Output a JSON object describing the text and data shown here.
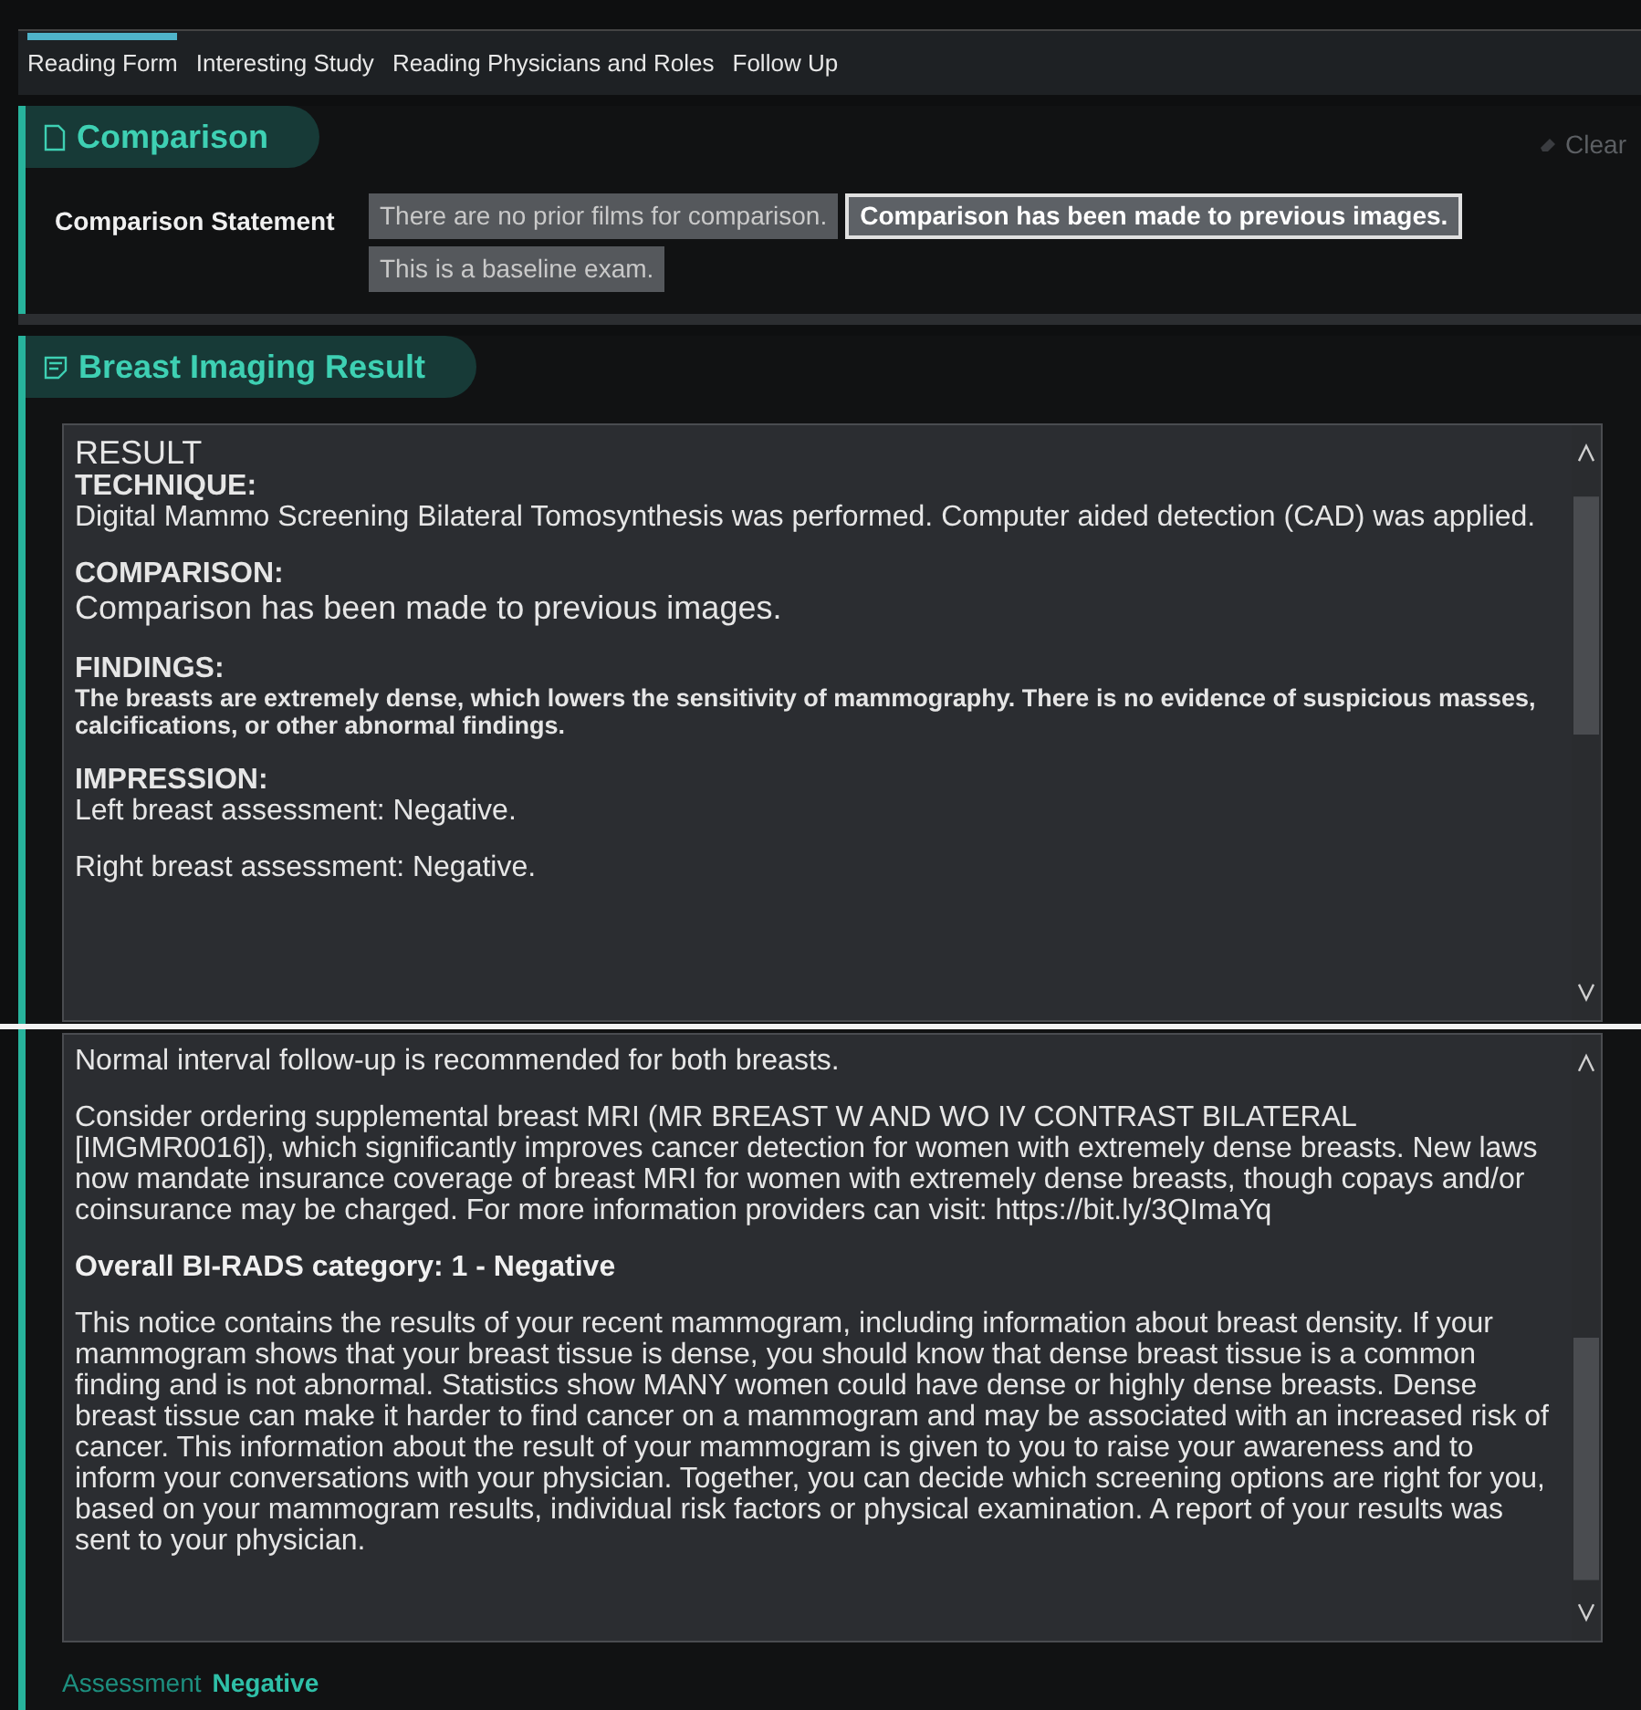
{
  "tabs": [
    {
      "label": "Reading Form",
      "selected": true
    },
    {
      "label": "Interesting Study",
      "selected": false
    },
    {
      "label": "Reading Physicians and Roles",
      "selected": false
    },
    {
      "label": "Follow Up",
      "selected": false
    }
  ],
  "comparison": {
    "title": "Comparison",
    "clear": "Clear",
    "statement_label": "Comparison Statement",
    "options": [
      {
        "label": "There are no prior films for comparison.",
        "selected": false
      },
      {
        "label": "Comparison has been made to previous images.",
        "selected": true
      },
      {
        "label": "This is a baseline exam.",
        "selected": false
      }
    ]
  },
  "result": {
    "title": "Breast Imaging Result",
    "panes": [
      {
        "blocks": [
          {
            "kind": "title",
            "text": "RESULT"
          },
          {
            "kind": "heading",
            "text": "TECHNIQUE:"
          },
          {
            "kind": "body",
            "text": "Digital Mammo Screening Bilateral Tomosynthesis was performed.  Computer aided detection (CAD) was applied."
          },
          {
            "kind": "heading",
            "text": "COMPARISON:"
          },
          {
            "kind": "large",
            "text": "Comparison has been made to previous images."
          },
          {
            "kind": "heading",
            "text": "FINDINGS:"
          },
          {
            "kind": "fine",
            "text": "The breasts are extremely dense, which lowers the sensitivity of mammography. There is no evidence of suspicious masses, calcifications, or other abnormal findings."
          },
          {
            "kind": "heading",
            "text": "IMPRESSION:"
          },
          {
            "kind": "body",
            "text": "Left breast assessment: Negative."
          },
          {
            "kind": "body",
            "text": "Right breast assessment: Negative."
          }
        ]
      },
      {
        "blocks": [
          {
            "kind": "body",
            "text": "Normal interval follow-up is recommended for both breasts."
          },
          {
            "kind": "body",
            "text": "Consider ordering supplemental breast MRI (MR BREAST W AND WO IV CONTRAST BILATERAL [IMGMR0016]), which significantly improves cancer detection for women with extremely dense breasts. New laws now mandate insurance coverage of breast MRI for women with extremely dense breasts, though copays and/or coinsurance may be charged. For more information providers can visit: https://bit.ly/3QImaYq"
          },
          {
            "kind": "emphasis",
            "text": "Overall BI-RADS category: 1 - Negative"
          },
          {
            "kind": "body",
            "text": "This notice contains the results of your recent mammogram, including information about breast density. If your mammogram shows that your breast tissue is dense, you should know that dense breast tissue is a common finding and is not abnormal.  Statistics show MANY women could have dense or highly dense breasts. Dense breast tissue can make it harder to find cancer on a mammogram and may be associated with an increased risk of cancer. This information about the result of your mammogram is given to you to raise your awareness and to inform your conversations with your physician. Together, you can decide which screening options are right for you, based on your mammogram results, individual risk factors or physical examination. A report of your results was sent to your physician."
          }
        ]
      }
    ],
    "assessment": {
      "label": "Assessment",
      "value": "Negative"
    }
  }
}
